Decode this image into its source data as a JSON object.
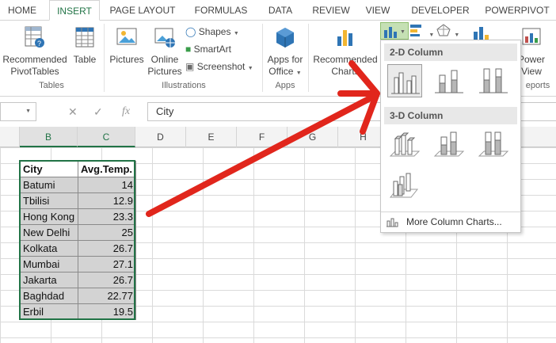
{
  "tabs": [
    "HOME",
    "INSERT",
    "PAGE LAYOUT",
    "FORMULAS",
    "DATA",
    "REVIEW",
    "VIEW",
    "DEVELOPER",
    "POWERPIVOT"
  ],
  "ribbon": {
    "recommended_pivottables": [
      "Recommended",
      "PivotTables"
    ],
    "table": "Table",
    "group_tables": "Tables",
    "pictures": "Pictures",
    "online_pictures": [
      "Online",
      "Pictures"
    ],
    "shapes": "Shapes",
    "smartart": "SmartArt",
    "screenshot": "Screenshot",
    "group_illustrations": "Illustrations",
    "apps_for_office": [
      "Apps for",
      "Office"
    ],
    "group_apps": "Apps",
    "recommended_charts": [
      "Recommended",
      "Charts"
    ],
    "power_view": [
      "Power",
      "View"
    ],
    "group_reports": "eports"
  },
  "formula_bar": {
    "fx": "fx",
    "content": "City"
  },
  "columns": [
    "B",
    "C",
    "D",
    "E",
    "F",
    "G",
    "H"
  ],
  "table": {
    "headers": [
      "City",
      "Avg.Temp."
    ],
    "rows": [
      [
        "Batumi",
        "14"
      ],
      [
        "Tbilisi",
        "12.9"
      ],
      [
        "Hong Kong",
        "23.3"
      ],
      [
        "New Delhi",
        "25"
      ],
      [
        "Kolkata",
        "26.7"
      ],
      [
        "Mumbai",
        "27.1"
      ],
      [
        "Jakarta",
        "26.7"
      ],
      [
        "Baghdad",
        "22.77"
      ],
      [
        "Erbil",
        "19.5"
      ]
    ]
  },
  "dropdown": {
    "section_2d": "2-D Column",
    "section_3d": "3-D Column",
    "more": "More Column Charts..."
  },
  "colors": {
    "accent_green": "#217346",
    "arrow_red": "#e1261c"
  }
}
